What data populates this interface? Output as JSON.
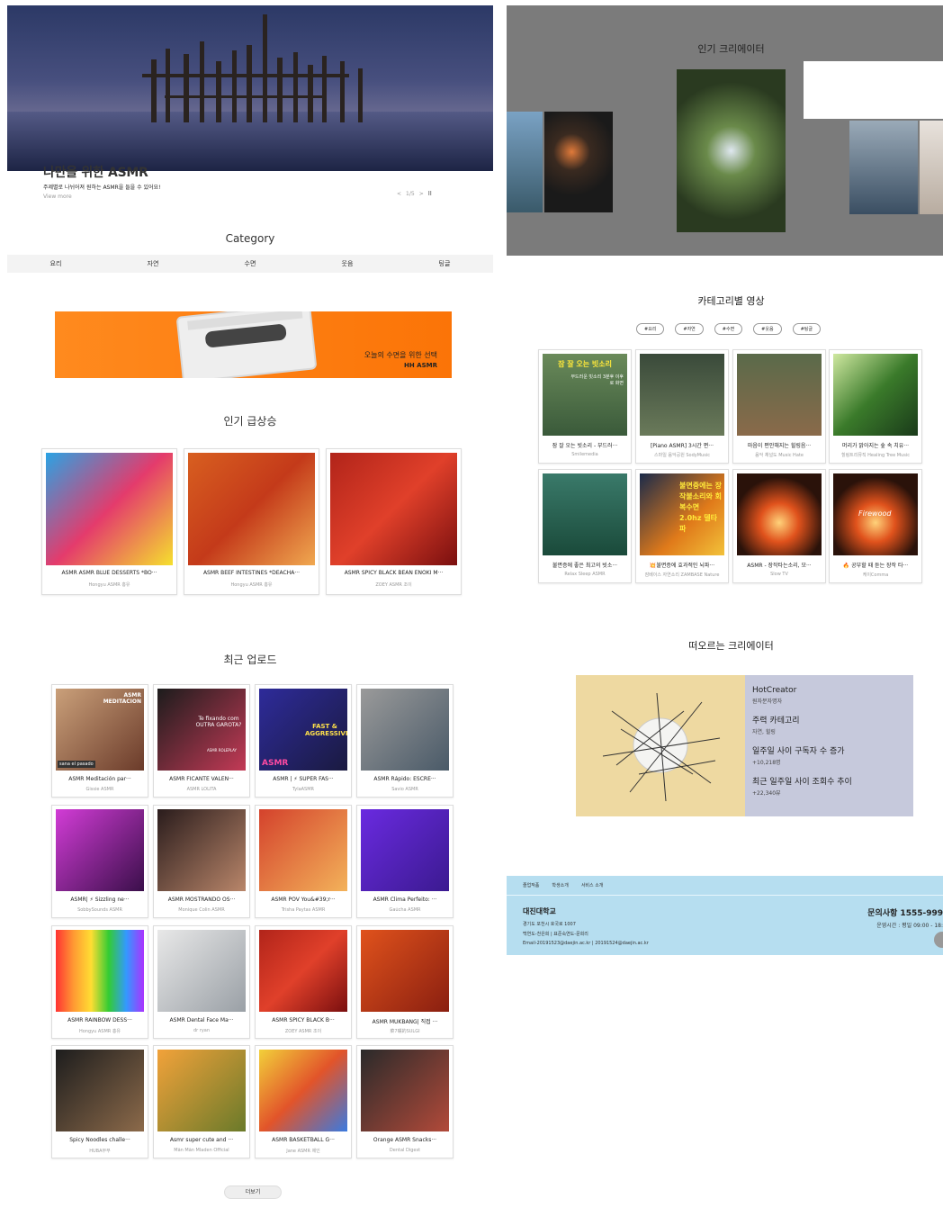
{
  "hero": {
    "title": "나만을 위한 ASMR",
    "desc": "주제별로 나뉘어져 원하는 ASMR을 들을 수 있어요!",
    "more": "View more",
    "prev": "<",
    "counter": "1/5",
    "next": ">",
    "pause": "II"
  },
  "category": {
    "title": "Category",
    "items": [
      "요리",
      "자연",
      "수면",
      "웃음",
      "팅글"
    ]
  },
  "banner": {
    "line1": "오늘의 수면을 위한 선택",
    "line2": "HH ASMR"
  },
  "trending": {
    "title": "인기 급상승",
    "cards": [
      {
        "title": "ASMR ASMR BLUE DESSERTS *BO···",
        "sub": "Hongyu ASMR 홍유"
      },
      {
        "title": "ASMR BEEF INTESTINES *DEACHA···",
        "sub": "Hongyu ASMR 홍유"
      },
      {
        "title": "ASMR SPICY BLACK BEAN ENOKI M···",
        "sub": "ZOEY ASMR 조이"
      }
    ]
  },
  "recent": {
    "title": "최근 업로드",
    "more": "더보기",
    "cards": [
      {
        "title": "ASMR Meditación par···",
        "sub": "Gissie ASMR",
        "overlay": "ASMR MEDITACION",
        "tag": "sana el pasado"
      },
      {
        "title": "ASMR FICANTE VALEN···",
        "sub": "ASMR LOLITA",
        "overlay": "Te fixando com OUTRA GAROTA?",
        "tag": "ASMR ROLEPLAY"
      },
      {
        "title": "ASMR | ⚡ SUPER FAS···",
        "sub": "TylaASMR",
        "overlay": "FAST & AGGRESSIVE",
        "tag": "ASMR"
      },
      {
        "title": "ASMR Rápido: ESCRE···",
        "sub": "Savio ASMR"
      },
      {
        "title": "ASMR| ⚡ Sizzling ne···",
        "sub": "SobbySounds ASMR"
      },
      {
        "title": "ASMR MOSTRANDO OS···",
        "sub": "Monique Colin ASMR"
      },
      {
        "title": "ASMR POV You&#39;r···",
        "sub": "Trisha Paytas ASMR"
      },
      {
        "title": "ASMR Clima Perfeito: ···",
        "sub": "Gaúcha ASMR"
      },
      {
        "title": "ASMR RAINBOW DESS···",
        "sub": "Hongyu ASMR 홍유"
      },
      {
        "title": "ASMR Dental Face Ma···",
        "sub": "dr ryan"
      },
      {
        "title": "ASMR SPICY BLACK B···",
        "sub": "ZOEY ASMR 조이"
      },
      {
        "title": "ASMR MUKBANG| 직접 ···",
        "sub": "菜7嘴的SULGI"
      },
      {
        "title": "Spicy Noodles challe···",
        "sub": "HUBA부부"
      },
      {
        "title": "Asmr super cute and ···",
        "sub": "Mắn Mắn Mladen Official"
      },
      {
        "title": "ASMR BASKETBALL G···",
        "sub": "Jane ASMR 제인"
      },
      {
        "title": "Orange ASMR Snacks···",
        "sub": "Dental Digest"
      }
    ]
  },
  "creators": {
    "title": "인기 크리에이터"
  },
  "categoryVideos": {
    "title": "카테고리별 영상",
    "chips": [
      "#요리",
      "#자연",
      "#수면",
      "#웃음",
      "#팅글"
    ],
    "cards": [
      {
        "title": "잠 잘 오는 빗소리 - 부드러···",
        "sub": "Smilemedia",
        "overlay": "잠 잘 오는 빗소리",
        "overlay2": "부드러운 빗소리 3분후 이후로 화면"
      },
      {
        "title": "[Piano ASMR] 3시간 편···",
        "sub": "스마일 음악공원 SodyMusic"
      },
      {
        "title": "마음이 편안해지는 힐링음···",
        "sub": "음악 채널도 Music Hate"
      },
      {
        "title": "머리가 맑아지는 숲 속 치유···",
        "sub": "힐링트리뮤직 Healing Tree Music"
      },
      {
        "title": "불면증에 좋은 최고의 빗소···",
        "sub": "Relax Sleep ASMR"
      },
      {
        "title": "💥불면증에 효과적인 뇌파···",
        "sub": "잠베이스 자연소리 ZAMBASE Nature",
        "overlay": "불면증에는 장작불소리와 회복수면 2.0hz 델타파"
      },
      {
        "title": "ASMR - 장작타는소리, 모···",
        "sub": "Slow TV"
      },
      {
        "title": "🔥 공부할 때 듣는 장작 타···",
        "sub": "케이Comma",
        "overlay": "Firewood"
      }
    ]
  },
  "rising": {
    "title": "떠오르는 크리에이터",
    "h1": "HotCreator",
    "v1": "원자분자명자",
    "h2": "주력 카테고리",
    "v2": "자연, 힐링",
    "h3": "일주일 사이 구독자 수 증가",
    "v3": "+10,218명",
    "h4": "최근 일주일 사이 조회수 추이",
    "v4": "+22,340뷰"
  },
  "footer": {
    "nav": [
      "졸업작품",
      "학생소개",
      "서비스 소개"
    ],
    "name": "대진대학교",
    "addr": "경기도 포천시 호국로 1007",
    "people": "백연도-천은희   |   표준숙연도-문희리",
    "email": "Email-20191523@daejin.ac.kr | 20191524@daejin.ac.kr",
    "phone": "문의사항 1555-999",
    "hours": "운영시간 : 평일 09:00 - 18:"
  }
}
